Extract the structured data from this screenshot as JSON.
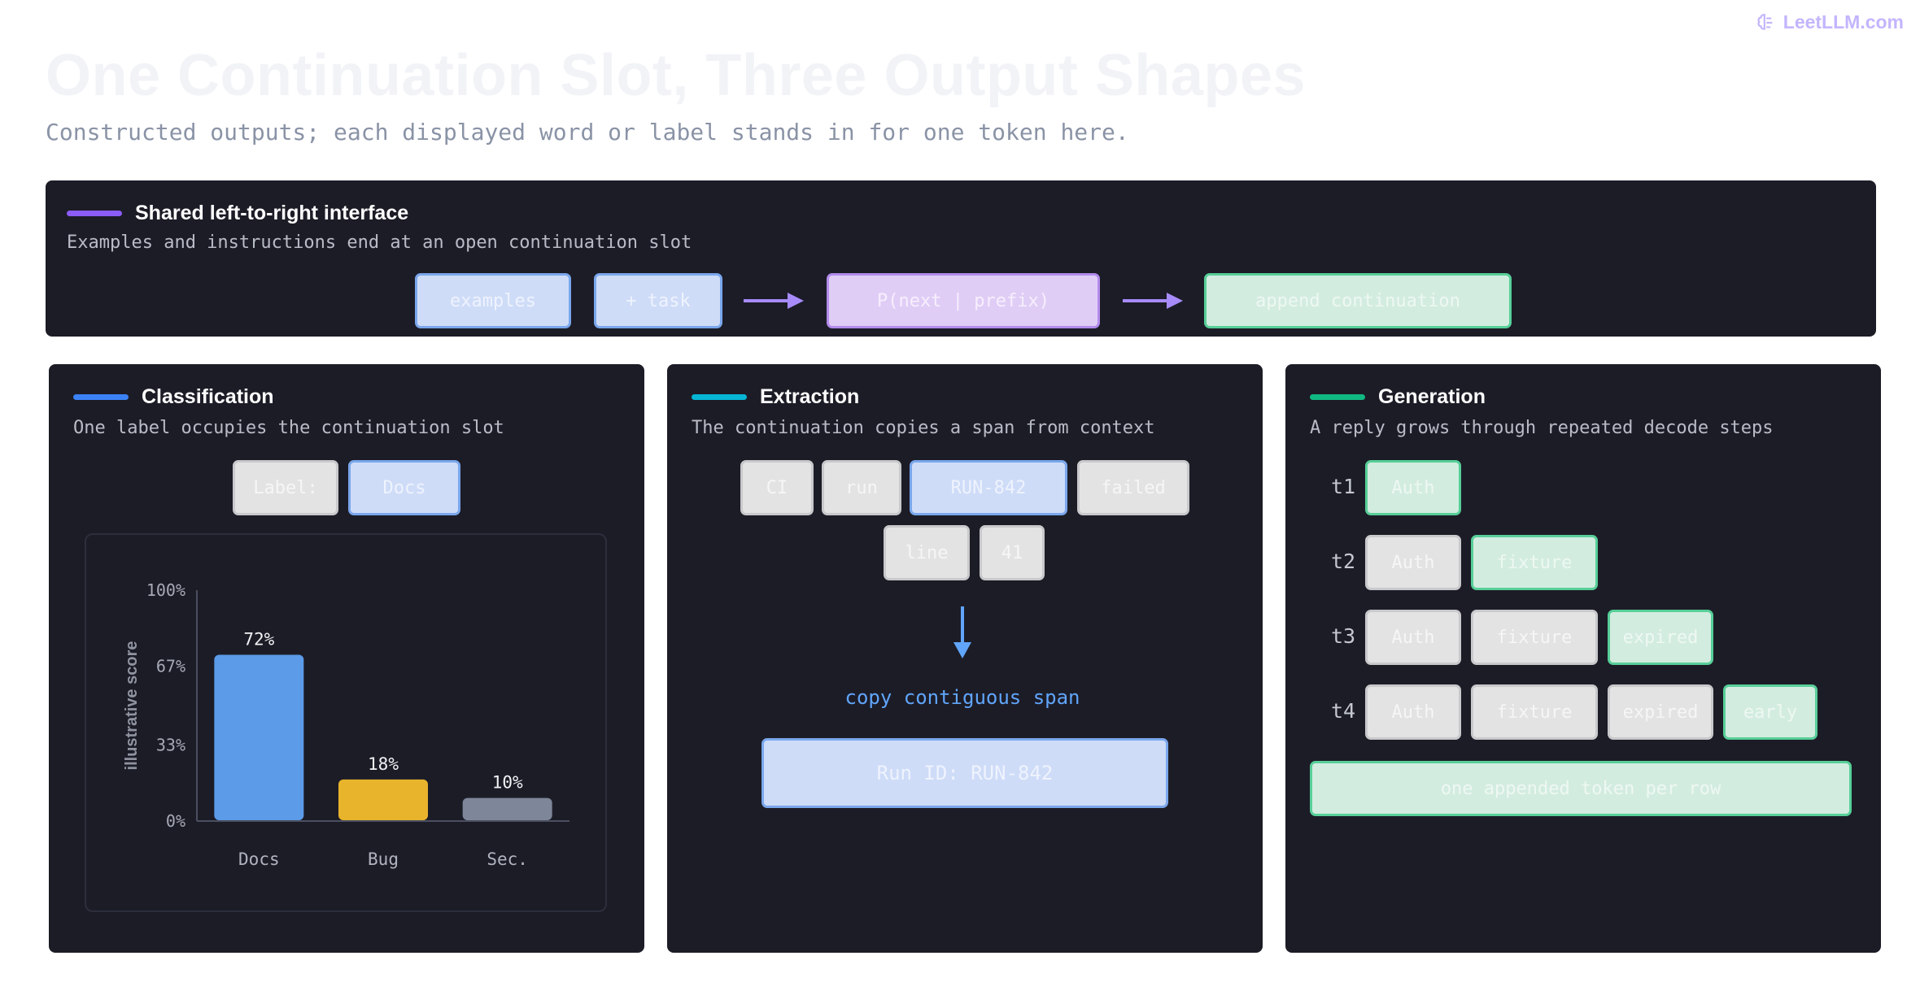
{
  "brand": {
    "name": "LeetLLM.com",
    "icon": "brain-icon"
  },
  "page": {
    "title": "One Continuation Slot, Three Output Shapes",
    "subtitle": "Constructed outputs; each displayed word or label stands in for one token here."
  },
  "top": {
    "title": "Shared left-to-right interface",
    "subtitle": "Examples and instructions end at an open continuation slot",
    "accent": "#8b5cf6",
    "flow": [
      "examples",
      "+ task",
      "P(next | prefix)",
      "append continuation"
    ]
  },
  "classification": {
    "title": "Classification",
    "subtitle": "One label occupies the continuation slot",
    "accent": "#3b82f6",
    "label_chips": [
      "Label:",
      "Docs"
    ]
  },
  "extraction": {
    "title": "Extraction",
    "subtitle": "The continuation copies a span from context",
    "accent": "#06b6d4",
    "tokens_row1": [
      "CI",
      "run",
      "RUN-842",
      "failed"
    ],
    "tokens_row2": [
      "line",
      "41"
    ],
    "copy_label": "copy contiguous span",
    "result": "Run ID: RUN-842"
  },
  "generation": {
    "title": "Generation",
    "subtitle": "A reply grows through repeated decode steps",
    "accent": "#10b981",
    "steps": [
      {
        "label": "t1",
        "tokens": [
          "Auth"
        ]
      },
      {
        "label": "t2",
        "tokens": [
          "Auth",
          "fixture"
        ]
      },
      {
        "label": "t3",
        "tokens": [
          "Auth",
          "fixture",
          "expired"
        ]
      },
      {
        "label": "t4",
        "tokens": [
          "Auth",
          "fixture",
          "expired",
          "early"
        ]
      }
    ],
    "footer": "one appended token per row"
  },
  "chart_data": {
    "type": "bar",
    "categories": [
      "Docs",
      "Bug",
      "Sec."
    ],
    "values": [
      72,
      18,
      10
    ],
    "value_labels": [
      "72%",
      "18%",
      "10%"
    ],
    "ylabel": "illustrative score",
    "ylim": [
      0,
      100
    ],
    "yticks": [
      0,
      33,
      67,
      100
    ],
    "ytick_labels": [
      "0%",
      "33%",
      "67%",
      "100%"
    ],
    "colors": [
      "#5b9be8",
      "#e8b42c",
      "#7d8799"
    ],
    "grid": false
  }
}
